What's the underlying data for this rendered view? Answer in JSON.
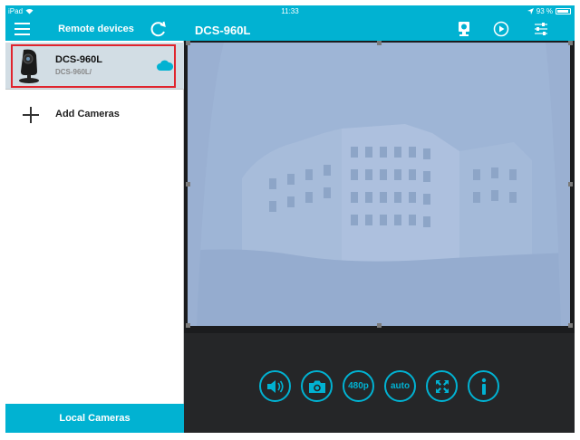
{
  "status_bar": {
    "device": "iPad",
    "time": "11:33",
    "battery": "93 %",
    "battery_level": 0.93
  },
  "sidebar": {
    "title": "Remote devices",
    "devices": [
      {
        "name": "DCS-960L",
        "subtitle": "DCS-960L/"
      }
    ],
    "add_label": "Add Cameras",
    "local_label": "Local Cameras"
  },
  "main": {
    "title": "DCS-960L",
    "controls": [
      {
        "name": "audio-button",
        "icon": "speaker-icon"
      },
      {
        "name": "snapshot-button",
        "icon": "camera-icon"
      },
      {
        "name": "resolution-button",
        "label": "480p"
      },
      {
        "name": "mode-button",
        "label": "auto"
      },
      {
        "name": "fullscreen-button",
        "icon": "expand-icon"
      },
      {
        "name": "info-button",
        "icon": "info-icon"
      }
    ]
  },
  "colors": {
    "accent": "#01b2d2",
    "highlight": "#e0242d",
    "control_bg": "#252628"
  }
}
